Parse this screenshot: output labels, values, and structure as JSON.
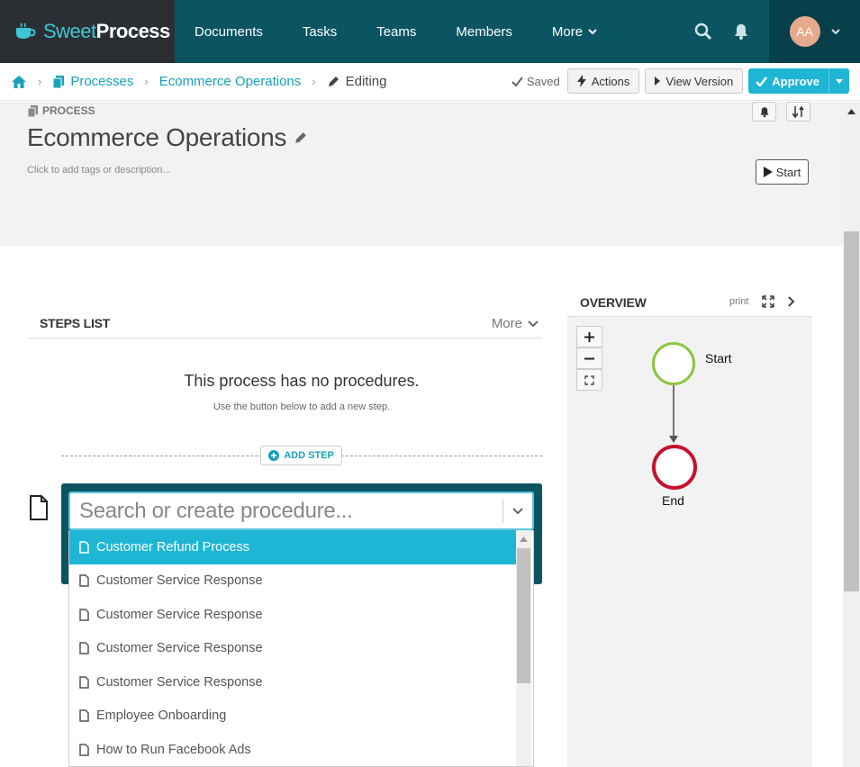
{
  "brand": {
    "sweet": "Sweet",
    "process": "Process"
  },
  "nav": {
    "items": [
      "Documents",
      "Tasks",
      "Teams",
      "Members",
      "More"
    ]
  },
  "user": {
    "initials": "AA"
  },
  "breadcrumb": {
    "processes": "Processes",
    "process": "Ecommerce Operations",
    "current": "Editing"
  },
  "actions": {
    "saved": "Saved",
    "actions": "Actions",
    "view_version": "View Version",
    "approve": "Approve"
  },
  "header": {
    "label": "PROCESS",
    "title": "Ecommerce Operations",
    "description": "Click to add tags or description...",
    "start": "Start"
  },
  "steps": {
    "title": "STEPS LIST",
    "more": "More",
    "empty_title": "This process has no procedures.",
    "empty_sub": "Use the button below to add a new step.",
    "add_step": "ADD STEP",
    "search_placeholder": "Search or create procedure...",
    "options": [
      "Customer Refund Process",
      "Customer Service Response",
      "Customer Service Response",
      "Customer Service Response",
      "Customer Service Response",
      "Employee Onboarding",
      "How to Run Facebook Ads"
    ]
  },
  "overview": {
    "title": "OVERVIEW",
    "print": "print",
    "start_label": "Start",
    "end_label": "End"
  },
  "colors": {
    "nav": "#0b5563",
    "brand_bg": "#2b2f33",
    "accent": "#1fb6d6",
    "start_node": "#8cc63f",
    "end_node": "#c8102e"
  }
}
